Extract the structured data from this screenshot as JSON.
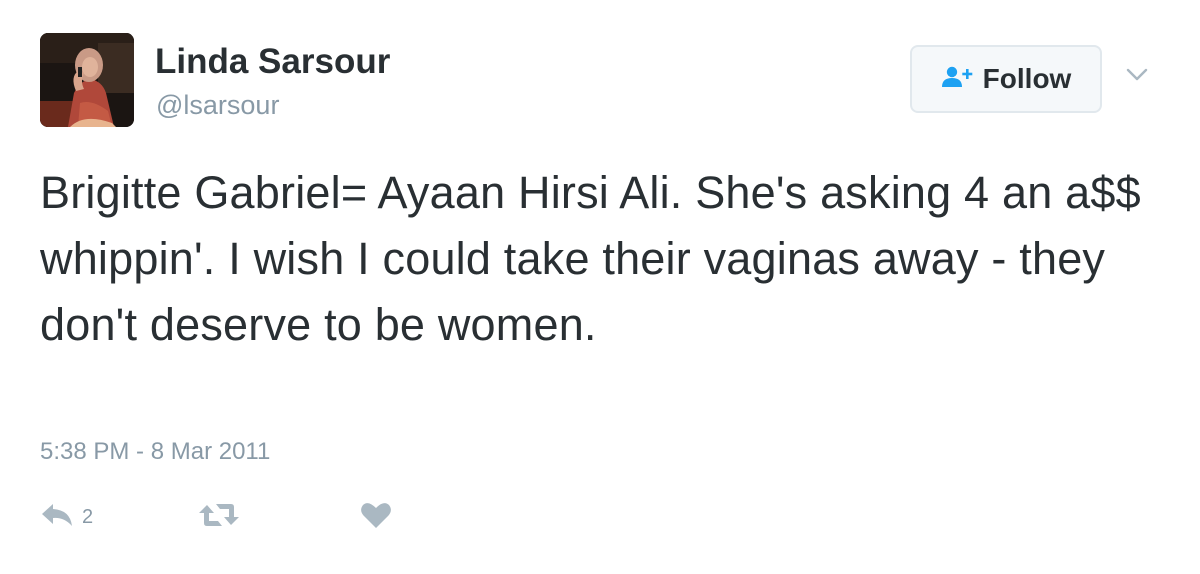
{
  "tweet": {
    "author": {
      "display_name": "Linda Sarsour",
      "handle": "@lsarsour",
      "avatar": "profile-photo"
    },
    "follow_button": {
      "label": "Follow",
      "icon": "add-user-icon"
    },
    "menu": {
      "icon": "chevron-down-icon"
    },
    "text": "Brigitte Gabriel= Ayaan Hirsi Ali. She's asking 4 an a$$ whippin'. I wish I could take their vaginas away - they don't deserve to be women.",
    "timestamp": "5:38 PM - 8 Mar 2011",
    "actions": {
      "reply": {
        "icon": "reply-icon",
        "count": "2"
      },
      "retweet": {
        "icon": "retweet-icon"
      },
      "like": {
        "icon": "heart-icon"
      }
    }
  },
  "colors": {
    "text_primary": "#292f33",
    "text_secondary": "#8899a6",
    "follow_icon": "#1da1f2",
    "button_border": "#e1e8ed",
    "button_background": "#f5f8fa",
    "action_icon": "#aab8c2"
  }
}
